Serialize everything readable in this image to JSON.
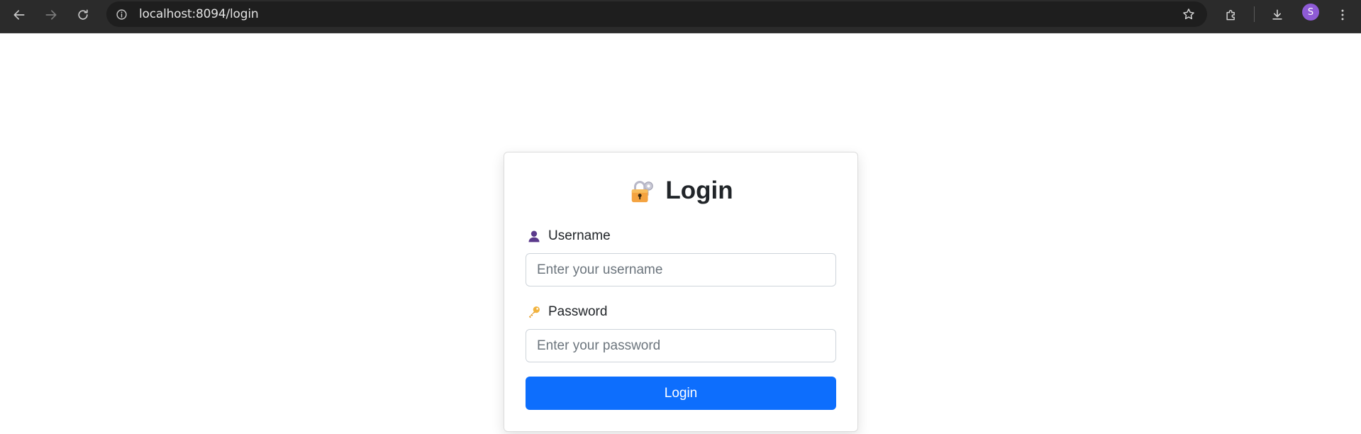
{
  "browser": {
    "url": "localhost:8094/login",
    "profile_initial": "S",
    "colors": {
      "toolbar": "#2b2b2b",
      "omnibox": "#1e1e1e",
      "avatar": "#8e5bd6"
    }
  },
  "login": {
    "title": "Login",
    "title_icon": "lock-with-key-icon",
    "username": {
      "label": "Username",
      "icon": "user-silhouette-icon",
      "placeholder": "Enter your username",
      "value": ""
    },
    "password": {
      "label": "Password",
      "icon": "key-icon",
      "placeholder": "Enter your password",
      "value": ""
    },
    "submit_label": "Login",
    "colors": {
      "primary": "#0d6efd",
      "text": "#212529",
      "border": "#ced4da"
    }
  }
}
